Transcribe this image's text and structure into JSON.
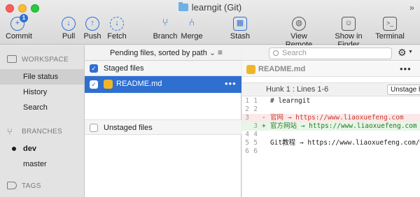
{
  "window": {
    "title": "learngit (Git)"
  },
  "toolbar": {
    "items": [
      {
        "label": "Commit",
        "glyph": "+",
        "badge": "1"
      },
      {
        "label": "Pull",
        "glyph": "↓"
      },
      {
        "label": "Push",
        "glyph": "↑"
      },
      {
        "label": "Fetch",
        "glyph": "↓"
      },
      {
        "label": "Branch",
        "glyph": "⑂"
      },
      {
        "label": "Merge",
        "glyph": "⑃"
      },
      {
        "label": "Stash",
        "glyph": "▦"
      },
      {
        "label": "View Remote",
        "glyph": "◍"
      },
      {
        "label": "Show in Finder",
        "glyph": "☺"
      },
      {
        "label": "Terminal",
        "glyph": ">_"
      }
    ],
    "overflow": "»"
  },
  "sidebar": {
    "workspace_label": "WORKSPACE",
    "workspace_items": [
      "File status",
      "History",
      "Search"
    ],
    "branches_label": "BRANCHES",
    "branches": [
      "dev",
      "master"
    ],
    "tags_label": "TAGS"
  },
  "middle": {
    "sort_label": "Pending files, sorted by path",
    "sort_arrow": "⌄",
    "list_icon": "≡",
    "staged_header": "Staged files",
    "staged_files": [
      {
        "name": "README.md",
        "more": "•••"
      }
    ],
    "unstaged_header": "Unstaged files"
  },
  "search": {
    "placeholder": "Search"
  },
  "diff": {
    "file_name": "README.md",
    "more": "•••",
    "hunk_label": "Hunk 1 : Lines 1-6",
    "hunk_button": "Unstage hunk",
    "lines": [
      {
        "old": "1",
        "new": "1",
        "sign": "",
        "text": "# learngit",
        "type": "ctx"
      },
      {
        "old": "2",
        "new": "2",
        "sign": "",
        "text": "",
        "type": "ctx"
      },
      {
        "old": "3",
        "new": "",
        "sign": "-",
        "text": "官网 → https://www.liaoxuefeng.com",
        "type": "del"
      },
      {
        "old": "",
        "new": "3",
        "sign": "+",
        "text": "官方网站 → https://www.liaoxuefeng.com",
        "type": "add"
      },
      {
        "old": "4",
        "new": "4",
        "sign": "",
        "text": "",
        "type": "ctx"
      },
      {
        "old": "5",
        "new": "5",
        "sign": "",
        "text": "Git教程 → https://www.liaoxuefeng.com/wiki/",
        "type": "ctx"
      },
      {
        "old": "6",
        "new": "6",
        "sign": "",
        "text": "",
        "type": "ctx"
      }
    ]
  },
  "colors": {
    "accent": "#2f6fd0",
    "deleted": "#c9372c",
    "added": "#1f7a1f",
    "file_icon": "#f1b52a"
  }
}
